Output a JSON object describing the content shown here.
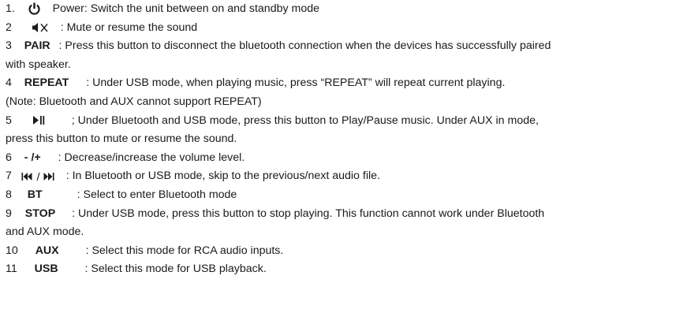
{
  "items": [
    {
      "num": "1.",
      "text": "Power: Switch the unit between on and standby mode"
    },
    {
      "num": "2",
      "text": ": Mute or resume the sound"
    },
    {
      "num": "3",
      "key": "PAIR",
      "text": ": Press this button to disconnect the bluetooth connection when the devices has successfully paired",
      "cont": "with speaker."
    },
    {
      "num": "4",
      "key": "REPEAT",
      "text": ": Under USB mode, when playing music, press “REPEAT” will repeat current playing.",
      "cont": "(Note: Bluetooth and AUX cannot support REPEAT)"
    },
    {
      "num": "5",
      "text": "; Under Bluetooth and USB mode, press this button to Play/Pause music. Under AUX in mode,",
      "cont": "press this button to mute or resume the sound."
    },
    {
      "num": "6",
      "key": "- /+",
      "text": ": Decrease/increase the volume level."
    },
    {
      "num": "7",
      "text": ": In Bluetooth or USB mode, skip to the previous/next audio file."
    },
    {
      "num": "8",
      "key": "BT",
      "text": ": Select to enter Bluetooth mode"
    },
    {
      "num": "9",
      "key": "STOP",
      "text": ": Under USB mode, press this button to stop playing. This function cannot work under Bluetooth",
      "cont": "and AUX mode."
    },
    {
      "num": "10",
      "key": "AUX",
      "text": ": Select this mode for RCA audio inputs."
    },
    {
      "num": "11",
      "key": "USB",
      "text": ": Select this mode for USB playback."
    }
  ],
  "icons": {
    "power": "power-icon",
    "mute": "mute-icon",
    "play_pause": "play-pause-icon",
    "skip": "skip-prev-next-icon"
  }
}
